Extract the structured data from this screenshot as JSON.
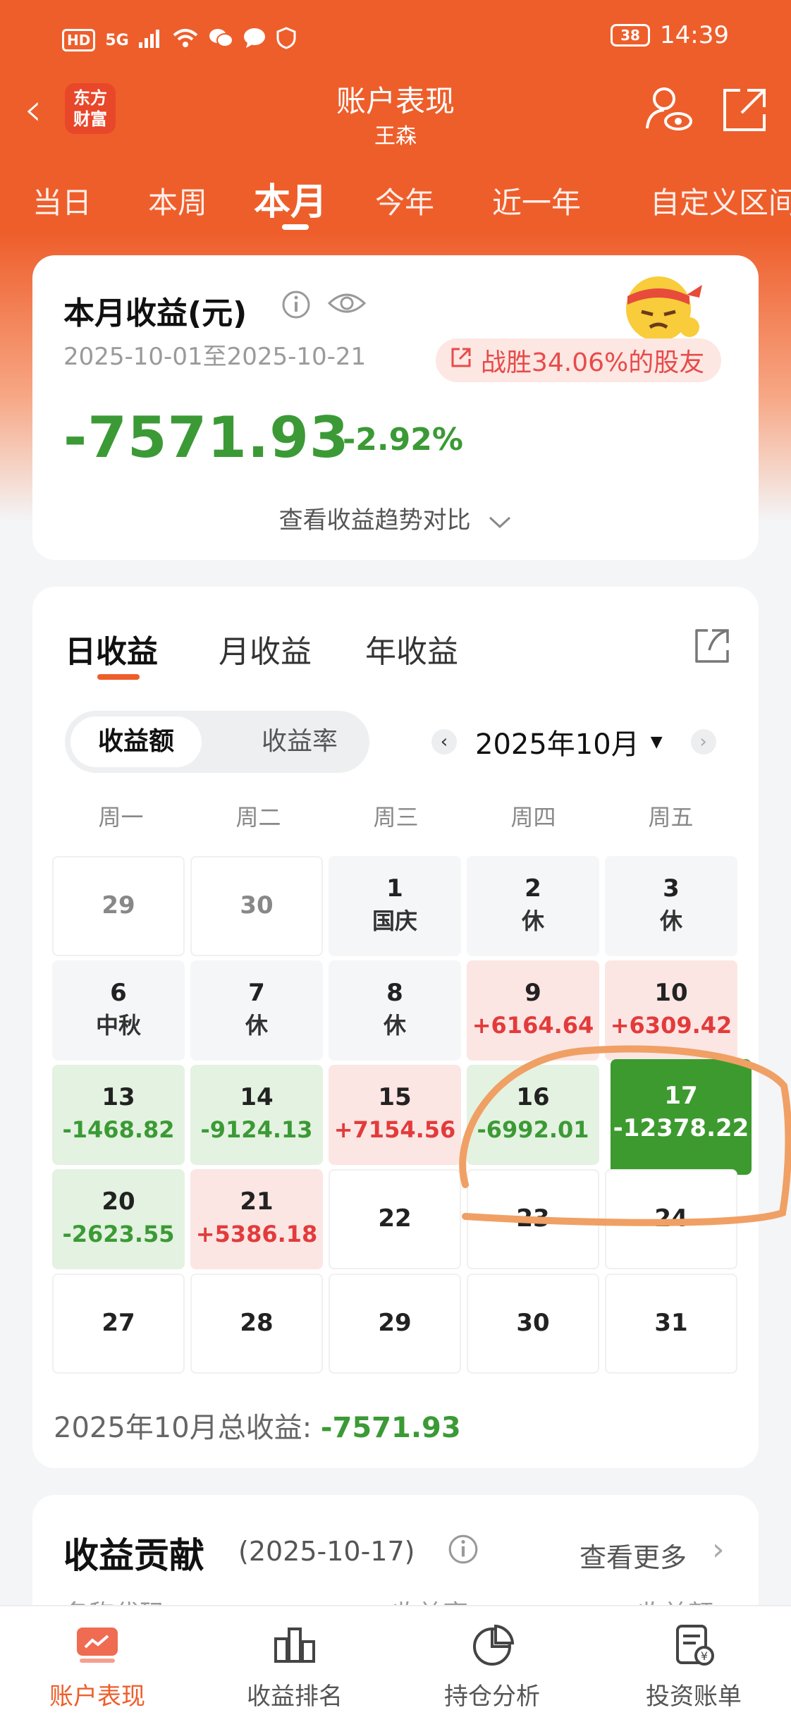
{
  "status_bar": {
    "network": "HD",
    "signal": "5G",
    "time": "14:39",
    "battery": "38"
  },
  "header": {
    "back": "‹",
    "logo_line1": "东方",
    "logo_line2": "财富",
    "title": "账户表现",
    "subtitle": "王森"
  },
  "period_tabs": [
    "当日",
    "本周",
    "本月",
    "今年",
    "近一年",
    "自定义区间"
  ],
  "summary": {
    "title": "本月收益(元)",
    "date_range": "2025-10-01至2025-10-21",
    "beat_text": "战胜34.06%的股友",
    "amount": "-7571.93",
    "pct": "-2.92%",
    "trend_link": "查看收益趋势对比"
  },
  "calendar": {
    "tabs": [
      "日收益",
      "月收益",
      "年收益"
    ],
    "toggle": [
      "收益额",
      "收益率"
    ],
    "month": "2025年10月",
    "weekdays": [
      "周一",
      "周二",
      "周三",
      "周四",
      "周五"
    ],
    "cells": [
      {
        "day": "29",
        "value": ""
      },
      {
        "day": "30",
        "value": ""
      },
      {
        "day": "1",
        "value": "国庆"
      },
      {
        "day": "2",
        "value": "休"
      },
      {
        "day": "3",
        "value": "休"
      },
      {
        "day": "6",
        "value": "中秋"
      },
      {
        "day": "7",
        "value": "休"
      },
      {
        "day": "8",
        "value": "休"
      },
      {
        "day": "9",
        "value": "+6164.64"
      },
      {
        "day": "10",
        "value": "+6309.42"
      },
      {
        "day": "13",
        "value": "-1468.82"
      },
      {
        "day": "14",
        "value": "-9124.13"
      },
      {
        "day": "15",
        "value": "+7154.56"
      },
      {
        "day": "16",
        "value": "-6992.01"
      },
      {
        "day": "17",
        "value": "-12378.22"
      },
      {
        "day": "20",
        "value": "-2623.55"
      },
      {
        "day": "21",
        "value": "+5386.18"
      },
      {
        "day": "22",
        "value": ""
      },
      {
        "day": "23",
        "value": ""
      },
      {
        "day": "24",
        "value": ""
      },
      {
        "day": "27",
        "value": ""
      },
      {
        "day": "28",
        "value": ""
      },
      {
        "day": "29",
        "value": ""
      },
      {
        "day": "30",
        "value": ""
      },
      {
        "day": "31",
        "value": ""
      }
    ],
    "total_label": "2025年10月总收益: ",
    "total_value": "-7571.93"
  },
  "contribution": {
    "title": "收益贡献",
    "date": "(2025-10-17)",
    "more": "查看更多",
    "more_arrow": "›",
    "columns": [
      "名称代码",
      "收益率",
      "收益额"
    ]
  },
  "bottom_nav": [
    "账户表现",
    "收益排名",
    "持仓分析",
    "投资账单"
  ],
  "colors": {
    "brand": "#ee5e2b",
    "gain": "#e33b3b",
    "loss": "#3b9a35",
    "annotation": "#f0a064"
  }
}
